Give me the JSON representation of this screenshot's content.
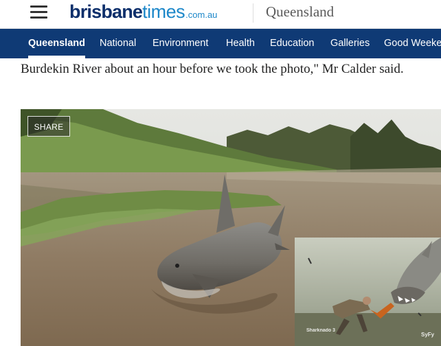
{
  "header": {
    "logo": {
      "part1": "brisbane",
      "part2": "times",
      "domain": ".com.au"
    },
    "section": "Queensland"
  },
  "nav": {
    "items": [
      {
        "label": "Queensland",
        "active": true
      },
      {
        "label": "National"
      },
      {
        "label": "Environment"
      },
      {
        "label": "Health"
      },
      {
        "label": "Education"
      },
      {
        "label": "Galleries"
      },
      {
        "label": "Good Weekend"
      }
    ]
  },
  "article": {
    "paragraph": "Burdekin River about an hour before we took the photo,\" Mr Calder said."
  },
  "photo": {
    "share_label": "SHARE",
    "inset_watermark": "Sharknado 3",
    "inset_channel": "SyFy"
  },
  "colors": {
    "nav_bg": "#0f3a75",
    "logo_dark": "#0d2f6b",
    "logo_light": "#1c87c9"
  }
}
